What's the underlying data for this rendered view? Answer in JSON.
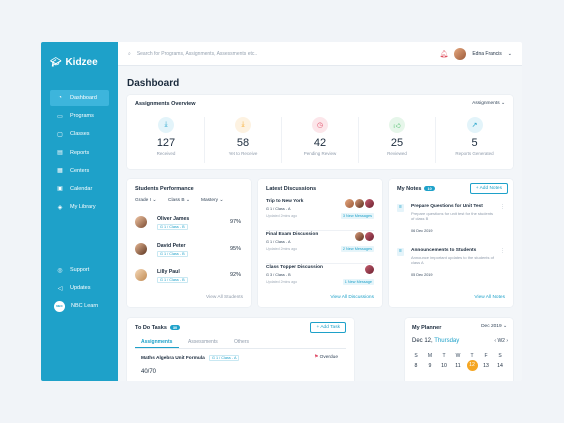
{
  "sidebar": {
    "logo": "Kidzee",
    "items": [
      {
        "label": "Dashboard",
        "icon": "dashboard-icon"
      },
      {
        "label": "Programs",
        "icon": "book-icon"
      },
      {
        "label": "Classes",
        "icon": "monitor-icon"
      },
      {
        "label": "Reports",
        "icon": "report-icon"
      },
      {
        "label": "Centers",
        "icon": "grid-icon"
      },
      {
        "label": "Calendar",
        "icon": "calendar-icon"
      },
      {
        "label": "My Library",
        "icon": "library-icon"
      }
    ],
    "bottom": [
      {
        "label": "Support",
        "icon": "support-icon"
      },
      {
        "label": "Updates",
        "icon": "megaphone-icon"
      },
      {
        "label": "NBC Learn",
        "icon": "nbc-logo"
      }
    ],
    "nbc_logo_text": "NBC"
  },
  "topbar": {
    "search_placeholder": "Search for Programs, Assignments, Assessments etc..",
    "user_name": "Edna Francis"
  },
  "page_title": "Dashboard",
  "overview": {
    "title": "Assignments Overview",
    "filter": "Assignments",
    "items": [
      {
        "value": "127",
        "label": "Received",
        "color": "#1ea1c9"
      },
      {
        "value": "58",
        "label": "Yet to Receive",
        "color": "#f5a623"
      },
      {
        "value": "42",
        "label": "Pending Review",
        "color": "#e0506a"
      },
      {
        "value": "25",
        "label": "Reviewed",
        "color": "#4cbf6b"
      },
      {
        "value": "5",
        "label": "Reports Generated",
        "color": "#1ea1c9"
      }
    ]
  },
  "performance": {
    "title": "Students Performance",
    "filters": [
      "Grade I",
      "Class B",
      "Mastery"
    ],
    "students": [
      {
        "name": "Oliver James",
        "tag": "G 1 / Class - B",
        "pct": "97%"
      },
      {
        "name": "David Peter",
        "tag": "G 1 / Class - B",
        "pct": "95%"
      },
      {
        "name": "Lilly Paul",
        "tag": "G 1 / Class - B",
        "pct": "92%"
      }
    ],
    "view_all": "View All Students"
  },
  "discussions": {
    "title": "Latest Discussions",
    "items": [
      {
        "title": "Trip to New York",
        "class": "G 1 / Class - A",
        "updated": "Updated 2mins ago",
        "messages": "3 New Messages"
      },
      {
        "title": "Final Exam Discussion",
        "class": "G 1 / Class - A",
        "updated": "Updated 2mins ago",
        "messages": "2 New Messages"
      },
      {
        "title": "Class Topper Discussion",
        "class": "G 3 / Class - B",
        "updated": "Updated 2mins ago",
        "messages": "1 New Message"
      }
    ],
    "view_all": "View All Discussions"
  },
  "notes": {
    "title": "My Notes",
    "count": "10",
    "add_label": "+ Add Notes",
    "items": [
      {
        "title": "Prepare Questions for Unit Test",
        "desc": "Prepare questions for unit test for the students of class B",
        "date": "06 Dec 2019"
      },
      {
        "title": "Announcements to Students",
        "desc": "Announce important updates to the students of class A",
        "date": "05 Dec 2019"
      }
    ],
    "view_all": "View All Notes"
  },
  "todo": {
    "title": "To Do Tasks",
    "count": "30",
    "add_label": "+ Add Task",
    "tabs": [
      "Assignments",
      "Assessments",
      "Others"
    ],
    "task_title": "Maths Algebra Unit Formula",
    "task_tag": "G 1 / Class - A",
    "task_status": "Overdue",
    "task_value": "40/70"
  },
  "planner": {
    "title": "My Planner",
    "month": "Dec 2019",
    "date_label": "Dec 12,",
    "day_label": "Thursday",
    "week": "W2",
    "days": [
      "S",
      "M",
      "T",
      "W",
      "T",
      "F",
      "S"
    ],
    "nums": [
      "8",
      "9",
      "10",
      "11",
      "12",
      "13",
      "14"
    ],
    "today_index": 4
  }
}
